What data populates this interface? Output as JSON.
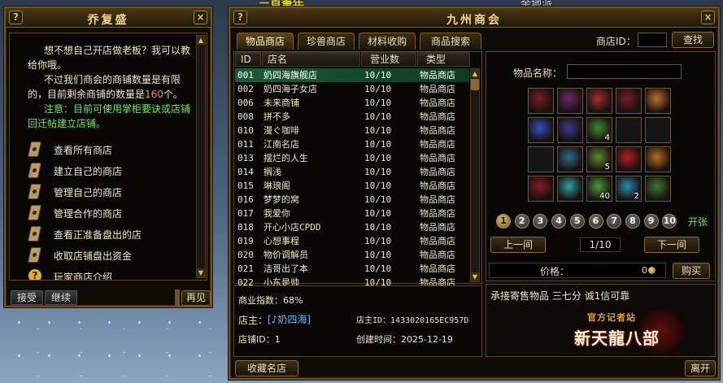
{
  "bg_text": {
    "top": "ㄧ首筆年",
    "right": "余地派"
  },
  "left_window": {
    "title": "乔复盛",
    "help_icon": "?",
    "close_icon": "×",
    "text_lines": [
      "想不想自己开店做老板？我可以",
      "教给你哦。",
      "不过我们商会的商铺数量是有限",
      "的，目前剩余商铺的数量是",
      "160",
      "个。"
    ],
    "notice": [
      "注意：目前可使用掌柜要诀或店",
      "铺回迁帖建立店铺。"
    ],
    "menu": [
      "查看所有商店",
      "建立自己的商店",
      "管理自己的商店",
      "管理合作的商店",
      "查看正准备盘出的店",
      "收取店铺盘出资金",
      "玩家商店介绍"
    ],
    "buttons": {
      "accept": "接受",
      "continue": "继续",
      "goodbye": "再见"
    }
  },
  "main_window": {
    "title": "九州商会",
    "help_icon": "?",
    "close_icon": "×",
    "tabs": [
      "物品商店",
      "珍兽商店",
      "材料收购",
      "商品搜索"
    ],
    "shop_id_label": "商店ID：",
    "search_button": "查找",
    "columns": [
      "ID",
      "店名",
      "营业数",
      "类型"
    ],
    "rows": [
      {
        "id": "001",
        "name": "奶四海旗舰店",
        "count": "10/10",
        "type": "物品商店"
      },
      {
        "id": "002",
        "name": "奶四海子女店",
        "count": "10/10",
        "type": "物品商店"
      },
      {
        "id": "006",
        "name": "未来商铺",
        "count": "10/10",
        "type": "物品商店"
      },
      {
        "id": "008",
        "name": "拼不多",
        "count": "10/10",
        "type": "物品商店"
      },
      {
        "id": "010",
        "name": "漫ぐ咖啡",
        "count": "10/10",
        "type": "物品商店"
      },
      {
        "id": "011",
        "name": "江南名店",
        "count": "10/10",
        "type": "物品商店"
      },
      {
        "id": "013",
        "name": "摆烂的人生",
        "count": "10/10",
        "type": "物品商店"
      },
      {
        "id": "014",
        "name": "搁浅",
        "count": "10/10",
        "type": "物品商店"
      },
      {
        "id": "015",
        "name": "琳琅阁",
        "count": "10/10",
        "type": "物品商店"
      },
      {
        "id": "016",
        "name": "梦梦的窝",
        "count": "10/10",
        "type": "物品商店"
      },
      {
        "id": "017",
        "name": "我爱你",
        "count": "10/10",
        "type": "物品商店"
      },
      {
        "id": "018",
        "name": "开心小店CPDD",
        "count": "10/10",
        "type": "物品商店"
      },
      {
        "id": "019",
        "name": "心想事程",
        "count": "10/10",
        "type": "物品商店"
      },
      {
        "id": "020",
        "name": "物价调解员",
        "count": "10/10",
        "type": "物品商店"
      },
      {
        "id": "021",
        "name": "洁哥出了本",
        "count": "10/10",
        "type": "物品商店"
      },
      {
        "id": "022",
        "name": "小东是帅",
        "count": "10/10",
        "type": "物品商店"
      }
    ],
    "selected_row": 0,
    "item_name_label": "物品名称：",
    "items": [
      {
        "icon": "warrior-portrait",
        "color": "#7a1c2a",
        "count": ""
      },
      {
        "icon": "warrior-portrait",
        "color": "#6a2a6a",
        "count": ""
      },
      {
        "icon": "warrior-portrait",
        "color": "#a03030",
        "count": ""
      },
      {
        "icon": "warrior-portrait",
        "color": "#7a1c2a",
        "count": ""
      },
      {
        "icon": "warrior-portrait",
        "color": "#c07030",
        "count": ""
      },
      {
        "icon": "blue-orb",
        "color": "#3050c0",
        "count": ""
      },
      {
        "icon": "warrior-portrait",
        "color": "#3a3a8a",
        "count": ""
      },
      {
        "icon": "green-feather",
        "color": "#3a8a2a",
        "count": "4"
      },
      {
        "icon": "",
        "color": "",
        "count": ""
      },
      {
        "icon": "",
        "color": "",
        "count": ""
      },
      {
        "icon": "",
        "color": "",
        "count": ""
      },
      {
        "icon": "warrior-portrait",
        "color": "#2a6a8a",
        "count": ""
      },
      {
        "icon": "green-feather",
        "color": "#5a8a2a",
        "count": "5"
      },
      {
        "icon": "fire-red-orb",
        "color": "#b02020",
        "count": ""
      },
      {
        "icon": "warrior-portrait",
        "color": "#b07020",
        "count": ""
      },
      {
        "icon": "armored-figure",
        "color": "#8a1a2a",
        "count": ""
      },
      {
        "icon": "cyan-gem",
        "color": "#30a0a0",
        "count": ""
      },
      {
        "icon": "green-gem",
        "color": "#4a9a3a",
        "count": "40"
      },
      {
        "icon": "ice-shard",
        "color": "#2a8ab0",
        "count": "2"
      },
      {
        "icon": "green-spear",
        "color": "#3a7a2a",
        "count": ""
      }
    ],
    "pages": [
      "1",
      "2",
      "3",
      "4",
      "5",
      "6",
      "7",
      "8",
      "9",
      "10"
    ],
    "current_page": "1",
    "expand_label": "开张",
    "prev_button": "上一间",
    "next_button": "下一间",
    "shop_pager": "1/10",
    "price_label": "价格：",
    "price_value": "0",
    "buy_button": "购买",
    "business_index": "商业指数：68%",
    "owner_label": "店主：",
    "owner_name": "[♪奶四海]",
    "owner_id": "店主ID：1433020165EC957D",
    "shop_id": "店铺ID：1",
    "created": "创建时间：2025-12-19",
    "favorite_button": "收藏名店",
    "slogan": "承接寄售物品 三七分 诚1信可靠",
    "leave_button": "离开",
    "logo_text": "新天龍八部",
    "logo_sub": "官方记者站"
  },
  "colors": {
    "gold": "#f2d48a",
    "green": "#7ae06a",
    "number": "#ff8a3a",
    "link": "#6ab8ff"
  }
}
